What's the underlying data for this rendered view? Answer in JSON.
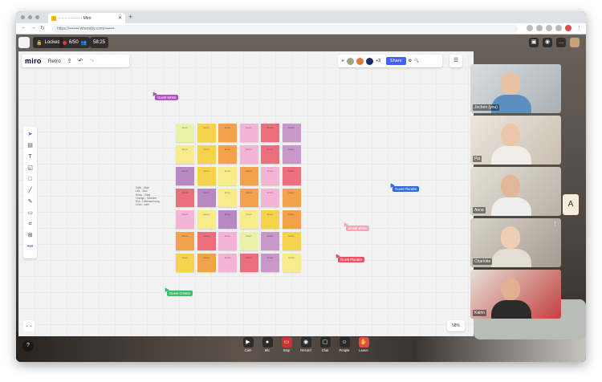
{
  "browser": {
    "tab_title": "···· ··········· - Miro",
    "url": "https://•••••••.whereby.com/•••••••",
    "new_tab": "+"
  },
  "topbar": {
    "lock_label": "Locked",
    "participants_count": "6/50",
    "timer": "58:25"
  },
  "miro": {
    "logo": "miro",
    "board_name": "Retro",
    "share_label": "Share",
    "extra_count": "+3",
    "zoom_level": "58%"
  },
  "toolbar_icons": [
    "cursor-icon",
    "frame-icon",
    "text-icon",
    "sticky-note-icon",
    "shape-icon",
    "pen-icon",
    "pencil-icon",
    "comment-icon",
    "crop-icon",
    "upload-icon",
    "more-icon"
  ],
  "notes": [
    {
      "color": "#e9f2a9",
      "text": "lorem"
    },
    {
      "color": "#f6d34c",
      "text": "lorem"
    },
    {
      "color": "#f2a24a",
      "text": "lorem"
    },
    {
      "color": "#f3b4d5",
      "text": "lorem"
    },
    {
      "color": "#ec6f7e",
      "text": "lorem"
    },
    {
      "color": "#c997c9",
      "text": "lorem"
    },
    {
      "color": "#f6ed8a",
      "text": "lorem"
    },
    {
      "color": "#f6d34c",
      "text": "lorem"
    },
    {
      "color": "#f2a24a",
      "text": "lorem"
    },
    {
      "color": "#f3b4d5",
      "text": "lorem"
    },
    {
      "color": "#ec6f7e",
      "text": "lorem"
    },
    {
      "color": "#c997c9",
      "text": "lorem"
    },
    {
      "color": "#b789c2",
      "text": "lorem"
    },
    {
      "color": "#f6d34c",
      "text": "lorem"
    },
    {
      "color": "#f6ed8a",
      "text": "lorem"
    },
    {
      "color": "#f2a24a",
      "text": "lorem"
    },
    {
      "color": "#f3b4d5",
      "text": "lorem"
    },
    {
      "color": "#ec6f7e",
      "text": "lorem"
    },
    {
      "color": "#ec6f7e",
      "text": "lorem"
    },
    {
      "color": "#b789c2",
      "text": "lorem"
    },
    {
      "color": "#f6ed8a",
      "text": "lorem"
    },
    {
      "color": "#f2a24a",
      "text": "lorem"
    },
    {
      "color": "#f3b4d5",
      "text": "lorem"
    },
    {
      "color": "#f2a24a",
      "text": "lorem"
    },
    {
      "color": "#f3b4d5",
      "text": "lorem"
    },
    {
      "color": "#f6ed8a",
      "text": "lorem"
    },
    {
      "color": "#b789c2",
      "text": "lorem"
    },
    {
      "color": "#f6ed8a",
      "text": "lorem"
    },
    {
      "color": "#f6d34c",
      "text": "lorem"
    },
    {
      "color": "#f2a24a",
      "text": "lorem"
    },
    {
      "color": "#f2a24a",
      "text": "lorem"
    },
    {
      "color": "#ec6f7e",
      "text": "lorem"
    },
    {
      "color": "#f3b4d5",
      "text": "lorem"
    },
    {
      "color": "#e9f2a9",
      "text": "lorem"
    },
    {
      "color": "#c997c9",
      "text": "lorem"
    },
    {
      "color": "#f6d34c",
      "text": "lorem"
    },
    {
      "color": "#f6d34c",
      "text": "lorem"
    },
    {
      "color": "#f2a24a",
      "text": "lorem"
    },
    {
      "color": "#f3b4d5",
      "text": "lorem"
    },
    {
      "color": "#ec6f7e",
      "text": "lorem"
    },
    {
      "color": "#c997c9",
      "text": "lorem"
    },
    {
      "color": "#f6ed8a",
      "text": "lorem"
    }
  ],
  "legend_lines": [
    "Gelb - Mad",
    "Lila - Sad",
    "Rosa - Glad",
    "Orange - Wonder",
    "Rot - Überraschung",
    "Grün - Idee"
  ],
  "cursors": [
    {
      "label": "Guest Writer",
      "color": "#b452c4"
    },
    {
      "label": "Guest Pluralist",
      "color": "#2f6ad6"
    },
    {
      "label": "Guest Writer",
      "color": "#f6a6b7"
    },
    {
      "label": "Guest Pluralist",
      "color": "#ef4d64"
    },
    {
      "label": "Guest Creator",
      "color": "#3dbd6b"
    }
  ],
  "participants": [
    {
      "name": "Jochen (you)"
    },
    {
      "name": "Pia"
    },
    {
      "name": "Anna"
    },
    {
      "name": "Charlotte"
    },
    {
      "name": "Katrin"
    }
  ],
  "side_avatar_letter": "A",
  "controls": [
    {
      "label": "Cam",
      "icon": "camera-icon"
    },
    {
      "label": "Mic",
      "icon": "microphone-icon"
    },
    {
      "label": "Stop",
      "icon": "stop-share-icon"
    },
    {
      "label": "Record",
      "icon": "record-icon"
    },
    {
      "label": "Chat",
      "icon": "chat-icon"
    },
    {
      "label": "People",
      "icon": "people-icon"
    },
    {
      "label": "Leave",
      "icon": "leave-icon"
    }
  ],
  "help": "?"
}
